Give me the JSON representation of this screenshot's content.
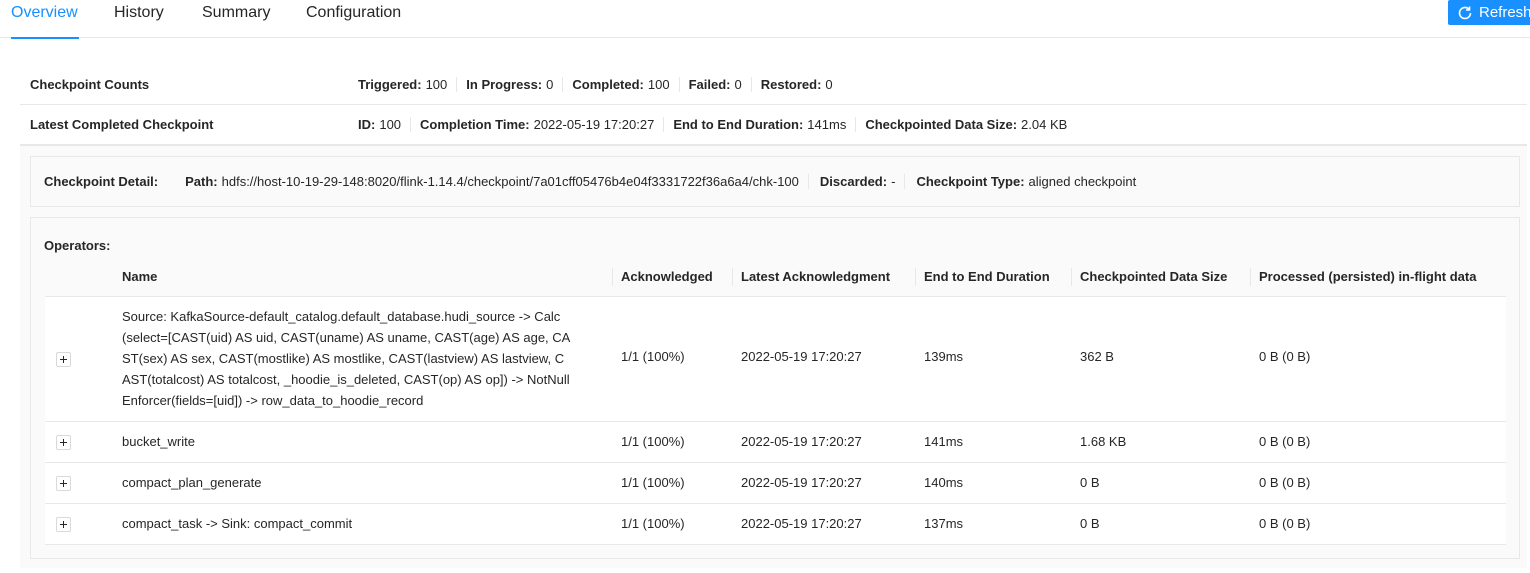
{
  "tabs": [
    {
      "label": "Overview",
      "active": true
    },
    {
      "label": "History",
      "active": false
    },
    {
      "label": "Summary",
      "active": false
    },
    {
      "label": "Configuration",
      "active": false
    }
  ],
  "refresh_label": "Refresh",
  "counts": {
    "label": "Checkpoint Counts",
    "triggered_label": "Triggered:",
    "triggered": "100",
    "in_progress_label": "In Progress:",
    "in_progress": "0",
    "completed_label": "Completed:",
    "completed": "100",
    "failed_label": "Failed:",
    "failed": "0",
    "restored_label": "Restored:",
    "restored": "0"
  },
  "latest": {
    "label": "Latest Completed Checkpoint",
    "id_label": "ID:",
    "id": "100",
    "completion_time_label": "Completion Time:",
    "completion_time": "2022-05-19 17:20:27",
    "e2e_label": "End to End Duration:",
    "e2e": "141ms",
    "size_label": "Checkpointed Data Size:",
    "size": "2.04 KB"
  },
  "detail": {
    "label": "Checkpoint Detail:",
    "path_label": "Path:",
    "path": "hdfs://host-10-19-29-148:8020/flink-1.14.4/checkpoint/7a01cff05476b4e04f3331722f36a6a4/chk-100",
    "discarded_label": "Discarded:",
    "discarded": "-",
    "type_label": "Checkpoint Type:",
    "type": "aligned checkpoint"
  },
  "operators": {
    "title": "Operators:",
    "columns": [
      "Name",
      "Acknowledged",
      "Latest Acknowledgment",
      "End to End Duration",
      "Checkpointed Data Size",
      "Processed (persisted) in-flight data"
    ],
    "rows": [
      {
        "name": "Source: KafkaSource-default_catalog.default_database.hudi_source -> Calc (select=[CAST(uid) AS uid, CAST(uname) AS uname, CAST(age) AS age, CAST(sex) AS sex, CAST(mostlike) AS mostlike, CAST(lastview) AS lastview, CAST(totalcost) AS totalcost, _hoodie_is_deleted, CAST(op) AS op]) -> NotNullEnforcer(fields=[uid]) -> row_data_to_hoodie_record",
        "acknowledged": "1/1 (100%)",
        "latest_ack": "2022-05-19 17:20:27",
        "e2e": "139ms",
        "size": "362 B",
        "inflight": "0 B (0 B)"
      },
      {
        "name": "bucket_write",
        "acknowledged": "1/1 (100%)",
        "latest_ack": "2022-05-19 17:20:27",
        "e2e": "141ms",
        "size": "1.68 KB",
        "inflight": "0 B (0 B)"
      },
      {
        "name": "compact_plan_generate",
        "acknowledged": "1/1 (100%)",
        "latest_ack": "2022-05-19 17:20:27",
        "e2e": "140ms",
        "size": "0 B",
        "inflight": "0 B (0 B)"
      },
      {
        "name": "compact_task -> Sink: compact_commit",
        "acknowledged": "1/1 (100%)",
        "latest_ack": "2022-05-19 17:20:27",
        "e2e": "137ms",
        "size": "0 B",
        "inflight": "0 B (0 B)"
      }
    ]
  }
}
